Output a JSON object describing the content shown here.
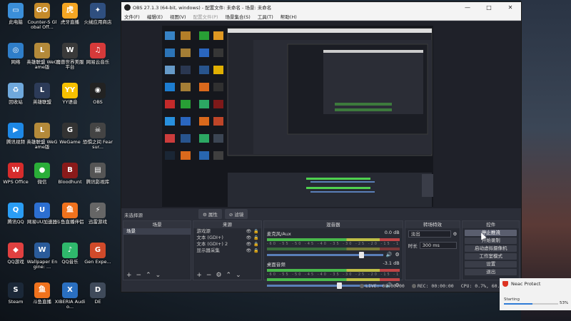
{
  "desktop_icons": [
    {
      "label": "此电脑",
      "color": "#3b8fd9",
      "glyph": "▭",
      "icon": "computer-icon"
    },
    {
      "label": "网络",
      "color": "#2f7ec9",
      "glyph": "◎",
      "icon": "network-icon"
    },
    {
      "label": "回收站",
      "color": "#6fa8dc",
      "glyph": "♻",
      "icon": "recycle-bin-icon"
    },
    {
      "label": "腾讯视频",
      "color": "#1e88e5",
      "glyph": "▶",
      "icon": "tencent-video-icon"
    },
    {
      "label": "WPS Office",
      "color": "#d62c2c",
      "glyph": "W",
      "icon": "wps-icon"
    },
    {
      "label": "腾讯QQ",
      "color": "#2a9df4",
      "glyph": "Q",
      "icon": "qq-icon"
    },
    {
      "label": "QQ游戏",
      "color": "#e04040",
      "glyph": "◆",
      "icon": "qq-game-icon"
    },
    {
      "label": "Steam",
      "color": "#1b2838",
      "glyph": "S",
      "icon": "steam-icon"
    },
    {
      "label": "Counter-S Global Off...",
      "color": "#c48a2a",
      "glyph": "GO",
      "icon": "csgo-icon"
    },
    {
      "label": "英雄联盟 WeGame版",
      "color": "#b48a3a",
      "glyph": "L",
      "icon": "lol-wegame-icon"
    },
    {
      "label": "英雄联盟",
      "color": "#2c3b58",
      "glyph": "L",
      "icon": "lol-icon"
    },
    {
      "label": "英雄联盟 WeGame版",
      "color": "#b48a3a",
      "glyph": "L",
      "icon": "lol-wegame-icon-2"
    },
    {
      "label": "微信",
      "color": "#2aae38",
      "glyph": "●",
      "icon": "wechat-icon"
    },
    {
      "label": "网易UU加速器",
      "color": "#2c6fd1",
      "glyph": "U",
      "icon": "uu-icon"
    },
    {
      "label": "Wallpaper Engine: ...",
      "color": "#2a5b9a",
      "glyph": "W",
      "icon": "wallpaper-engine-icon"
    },
    {
      "label": "斗鱼直播",
      "color": "#f0721d",
      "glyph": "鱼",
      "icon": "douyu-icon"
    },
    {
      "label": "虎牙直播",
      "color": "#f5a623",
      "glyph": "虎",
      "icon": "huya-icon"
    },
    {
      "label": "魔兽世界美服平台",
      "color": "#3a3a3a",
      "glyph": "W",
      "icon": "wow-icon"
    },
    {
      "label": "YY语音",
      "color": "#f6c000",
      "glyph": "YY",
      "icon": "yy-icon"
    },
    {
      "label": "WeGame",
      "color": "#333",
      "glyph": "G",
      "icon": "wegame-icon"
    },
    {
      "label": "Bloodhunt",
      "color": "#8a1a1a",
      "glyph": "B",
      "icon": "bloodhunt-icon"
    },
    {
      "label": "斗鱼直播伴侣",
      "color": "#f0721d",
      "glyph": "鱼",
      "icon": "douyu-companion-icon"
    },
    {
      "label": "QQ音乐",
      "color": "#2fb86c",
      "glyph": "♪",
      "icon": "qq-music-icon"
    },
    {
      "label": "XIBERIA Audio...",
      "color": "#2a6fc0",
      "glyph": "X",
      "icon": "xiberia-icon"
    },
    {
      "label": "火绒应用商店",
      "color": "#2f4f7f",
      "glyph": "✦",
      "icon": "store-icon"
    },
    {
      "label": "网易云音乐",
      "color": "#d63a3a",
      "glyph": "♫",
      "icon": "netease-music-icon"
    },
    {
      "label": "OBS",
      "color": "#222",
      "glyph": "◉",
      "icon": "obs-icon"
    },
    {
      "label": "恐惧之间 Fear sur...",
      "color": "#444",
      "glyph": "☠",
      "icon": "fear-icon"
    },
    {
      "label": "腾讯影视库",
      "color": "#555",
      "glyph": "▤",
      "icon": "tencent-library-icon"
    },
    {
      "label": "迅雷游戏",
      "color": "#666",
      "glyph": "⚡",
      "icon": "xunlei-game-icon"
    },
    {
      "label": "Gen Expe...",
      "color": "#d04a2a",
      "glyph": "G",
      "icon": "genexpe-icon"
    },
    {
      "label": "DE",
      "color": "#3f4a5a",
      "glyph": "D",
      "icon": "de-icon"
    }
  ],
  "window": {
    "title": "OBS 27.1.3 (64-bit, windows) - 配置文件: 未命名 - 场景: 未命名",
    "menu": [
      "文件(F)",
      "编辑(E)",
      "视图(V)",
      "配置文件(P)",
      "场景集合(S)",
      "工具(T)",
      "帮助(H)"
    ],
    "controls": [
      "—",
      "□",
      "✕"
    ]
  },
  "scene_label": "未选择源",
  "dock_tabs": [
    "⚙ 属性",
    "⊘ 滤镜"
  ],
  "docks": {
    "scenes": {
      "title": "场景",
      "items": [
        "场景"
      ]
    },
    "sources": {
      "title": "来源",
      "items": [
        "游戏源",
        "文本 (GDI+)",
        "文本 (GDI+) 2",
        "显示器采集"
      ]
    },
    "mixer": {
      "title": "混音器",
      "channels": [
        {
          "name": "麦克风/Aux",
          "db": "0.0 dB",
          "level": 0.82
        },
        {
          "name": "桌面音频",
          "db": "-3.1 dB",
          "level": 0.63
        }
      ],
      "ticks": "-60 -55 -50 -45 -40 -35 -30 -25 -20 -15 -10 -5 0"
    },
    "transitions": {
      "title": "转场特效",
      "type": "淡出",
      "duration_label": "时长",
      "duration": "300 ms"
    },
    "controls": {
      "title": "控件",
      "buttons": [
        "停止推流",
        "开始录制",
        "启动虚拟摄像机",
        "工作室模式",
        "设置",
        "退出"
      ]
    }
  },
  "status": {
    "live": "LIVE: 00:00:00",
    "rec": "REC: 00:00:00",
    "cpu": "CPU: 0.7%, 60.00 fps"
  },
  "neac": {
    "title": "Neac Protect",
    "status": "Starting",
    "percent": "53%",
    "progress": 0.53
  }
}
